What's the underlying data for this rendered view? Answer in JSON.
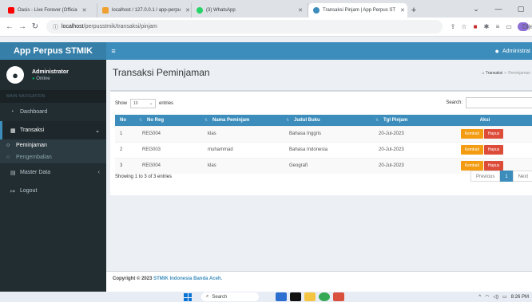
{
  "browser": {
    "tabs": [
      {
        "title": "Oasis - Live Forever (Officia",
        "fav_color": "#ff0000",
        "active": false
      },
      {
        "title": "localhost / 127.0.0.1 / app-perpu",
        "fav_color": "#f0a030",
        "active": false
      },
      {
        "title": "(3) WhatsApp",
        "fav_color": "#25d366",
        "active": false
      },
      {
        "title": "Transaksi Pinjam | App Perpus ST",
        "fav_color": "#3c8dbc",
        "active": true
      }
    ],
    "url_host": "localhost",
    "url_path": "/perpusstmik/transaksi/pinjam",
    "profile_label": "Dijeda"
  },
  "app": {
    "logo": "App Perpus STMIK",
    "user_top": "Administrat",
    "user_name": "Administrator",
    "user_status": "Online"
  },
  "sidebar": {
    "header": "MAIN NAVIGATION",
    "items": [
      {
        "label": "Dashboard",
        "icon": "dashboard-icon"
      },
      {
        "label": "Transaksi",
        "icon": "table-icon"
      },
      {
        "label": "Master Data",
        "icon": "database-icon"
      },
      {
        "label": "Logout",
        "icon": "logout-icon"
      }
    ],
    "sub": [
      {
        "label": "Peminjaman",
        "active": true
      },
      {
        "label": "Pengembalian",
        "active": false
      }
    ]
  },
  "content": {
    "title": "Transaksi Peminjaman",
    "breadcrumb": [
      "Transaksi",
      "Peminjaman"
    ]
  },
  "table": {
    "show_label": "Show",
    "entries_value": "10",
    "entries_label": "entries",
    "search_label": "Search:",
    "columns": [
      "No",
      "No Reg",
      "Nama Peminjam",
      "Judul Buku",
      "Tgl Pinjam",
      "Aksi"
    ],
    "rows": [
      {
        "no": "1",
        "reg": "REG004",
        "nama": "klas",
        "judul": "Bahasa Inggris",
        "tgl": "20-Jul-2023"
      },
      {
        "no": "2",
        "reg": "REG003",
        "nama": "muhammad",
        "judul": "Bahasa Indonesia",
        "tgl": "20-Jul-2023"
      },
      {
        "no": "3",
        "reg": "REG004",
        "nama": "klas",
        "judul": "Geografi",
        "tgl": "20-Jul-2023"
      }
    ],
    "btn_kembali": "Kembali",
    "btn_hapus": "Hapus",
    "info": "Showing 1 to 3 of 3 entries",
    "prev": "Previous",
    "page": "1",
    "next": "Next"
  },
  "footer": {
    "prefix": "Copyright © 2023",
    "org": "STMIK Indonesia Banda Aceh."
  },
  "taskbar": {
    "search": "Search",
    "time": "8:26 PM"
  }
}
